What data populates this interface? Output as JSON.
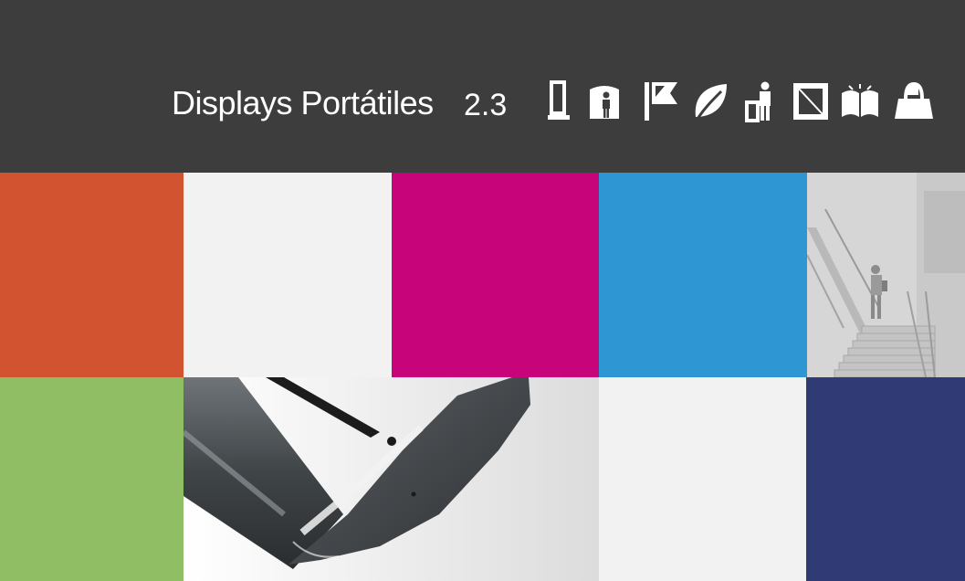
{
  "header": {
    "title": "Displays Portátiles",
    "section_number": "2.3",
    "background_color": "#3d3d3d",
    "text_color": "#ffffff",
    "category_icons": [
      "rollup-banner-icon",
      "person-display-icon",
      "flag-icon",
      "leaf-icon",
      "person-counter-icon",
      "frame-icon",
      "open-book-icon",
      "bag-icon"
    ]
  },
  "grid": {
    "colors": {
      "orange": "#d2532f",
      "light_grey": "#f2f2f2",
      "magenta": "#c8047a",
      "blue": "#2e96d2",
      "green": "#8fbe64",
      "navy": "#303a74"
    },
    "photos": [
      "stairway-photo",
      "display-stand-base-photo"
    ]
  }
}
